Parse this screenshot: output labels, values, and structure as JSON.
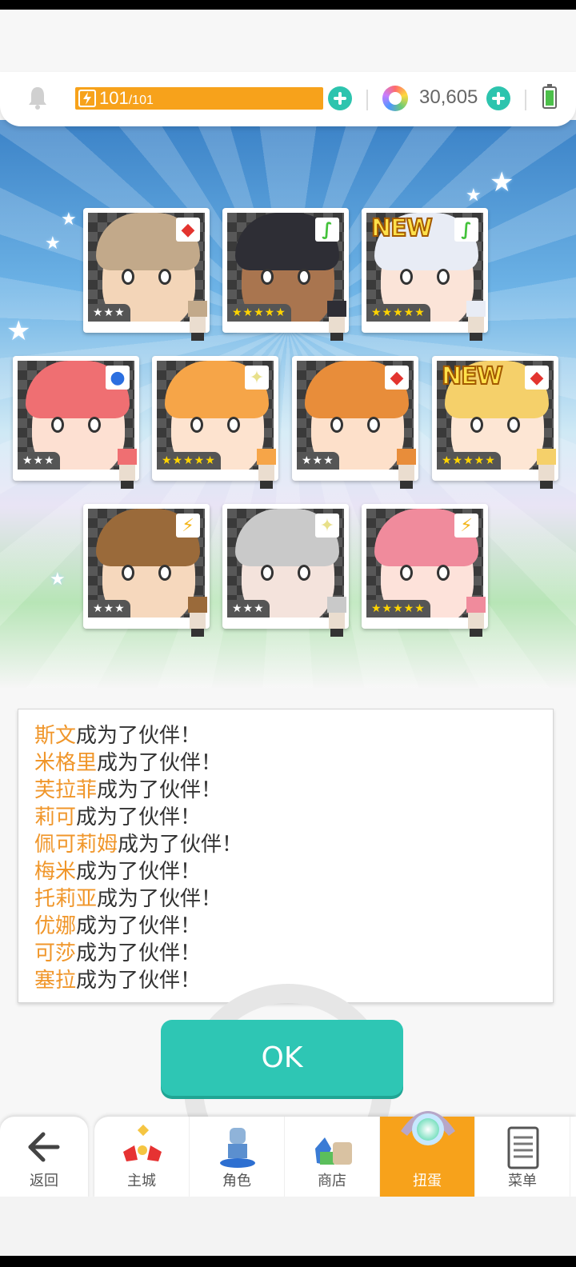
{
  "status": {
    "energy_current": "101",
    "energy_max": "/101",
    "gems": "30,605"
  },
  "cards": [
    {
      "element": "fire",
      "element_glyph": "◆",
      "rarity": "★★★",
      "new": false,
      "hair": "#c2a98a",
      "skin": "#f3d5b8"
    },
    {
      "element": "wind",
      "element_glyph": "∫",
      "rarity": "★★★★★",
      "new": false,
      "hair": "#2e2e35",
      "skin": "#a9754f"
    },
    {
      "element": "wind",
      "element_glyph": "∫",
      "rarity": "★★★★★",
      "new": true,
      "hair": "#e8ecf5",
      "skin": "#fbe4d8"
    },
    {
      "element": "water",
      "element_glyph": "●",
      "rarity": "★★★",
      "new": false,
      "hair": "#ef6f72",
      "skin": "#fde0d2"
    },
    {
      "element": "light",
      "element_glyph": "✦",
      "rarity": "★★★★★",
      "new": false,
      "hair": "#f6a548",
      "skin": "#fde3cf"
    },
    {
      "element": "fire",
      "element_glyph": "◆",
      "rarity": "★★★",
      "new": false,
      "hair": "#e88d3a",
      "skin": "#fde0ca"
    },
    {
      "element": "fire",
      "element_glyph": "◆",
      "rarity": "★★★★★",
      "new": true,
      "hair": "#f5d06a",
      "skin": "#fde6d4"
    },
    {
      "element": "thunder",
      "element_glyph": "⚡",
      "rarity": "★★★",
      "new": false,
      "hair": "#9a6a3a",
      "skin": "#f6d8bd"
    },
    {
      "element": "light",
      "element_glyph": "✦",
      "rarity": "★★★",
      "new": false,
      "hair": "#c9c9c9",
      "skin": "#f4e3dc"
    },
    {
      "element": "thunder",
      "element_glyph": "⚡",
      "rarity": "★★★★★",
      "new": false,
      "hair": "#f08b9c",
      "skin": "#fde2da"
    }
  ],
  "new_label": "NEW",
  "messages": [
    {
      "name": "斯文",
      "suffix": "成为了伙伴！"
    },
    {
      "name": "米格里",
      "suffix": "成为了伙伴！"
    },
    {
      "name": "芙拉菲",
      "suffix": "成为了伙伴！"
    },
    {
      "name": "莉可",
      "suffix": "成为了伙伴！"
    },
    {
      "name": "佩可莉姆",
      "suffix": "成为了伙伴！"
    },
    {
      "name": "梅米",
      "suffix": "成为了伙伴！"
    },
    {
      "name": "托莉亚",
      "suffix": "成为了伙伴！"
    },
    {
      "name": "优娜",
      "suffix": "成为了伙伴！"
    },
    {
      "name": "可莎",
      "suffix": "成为了伙伴！"
    },
    {
      "name": "塞拉",
      "suffix": "成为了伙伴！"
    }
  ],
  "ok_label": "OK",
  "nav": {
    "back": "返回",
    "items": [
      {
        "label": "主城",
        "icon": "castle-icon"
      },
      {
        "label": "角色",
        "icon": "character-icon"
      },
      {
        "label": "商店",
        "icon": "shop-icon"
      },
      {
        "label": "扭蛋",
        "icon": "gacha-icon",
        "active": true
      },
      {
        "label": "菜单",
        "icon": "menu-icon"
      }
    ]
  }
}
